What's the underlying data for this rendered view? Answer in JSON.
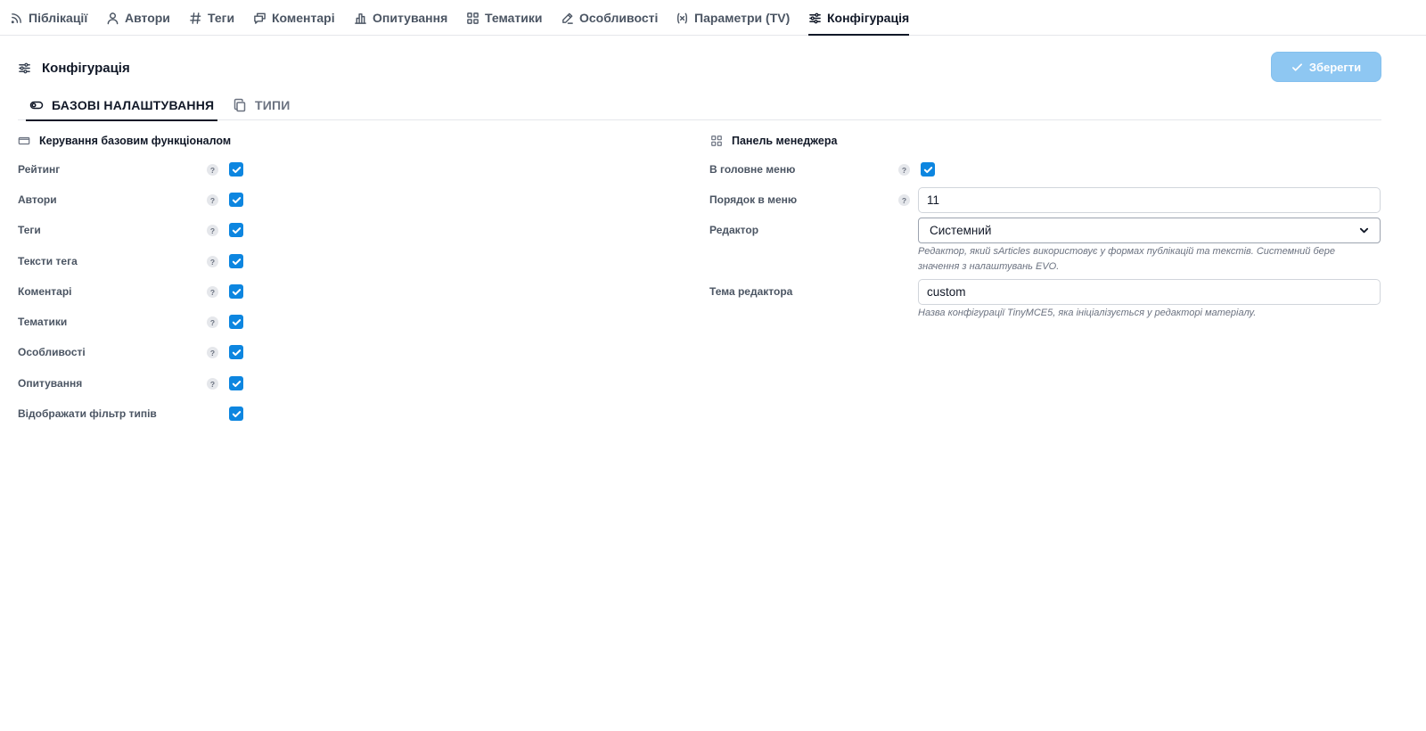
{
  "topnav": {
    "items": [
      {
        "label": "Піблікації",
        "icon": "rss-icon"
      },
      {
        "label": "Автори",
        "icon": "user-icon"
      },
      {
        "label": "Теги",
        "icon": "hash-icon"
      },
      {
        "label": "Коментарі",
        "icon": "comments-icon"
      },
      {
        "label": "Опитування",
        "icon": "chart-bar-icon"
      },
      {
        "label": "Тематики",
        "icon": "grid-icon"
      },
      {
        "label": "Особливості",
        "icon": "pen-icon"
      },
      {
        "label": "Параметри (TV)",
        "icon": "variable-icon"
      },
      {
        "label": "Конфігурація",
        "icon": "sliders-icon",
        "active": true
      }
    ]
  },
  "header": {
    "title": "Конфігурація",
    "save_label": "Зберегти"
  },
  "subtabs": [
    {
      "label": "БАЗОВІ НАЛАШТУВАННЯ",
      "icon": "toggle-icon",
      "active": true
    },
    {
      "label": "ТИПИ",
      "icon": "copy-icon"
    }
  ],
  "basic": {
    "title": "Керування базовим функціоналом",
    "rows": [
      {
        "label": "Рейтинг",
        "help": "?",
        "checked": true
      },
      {
        "label": "Автори",
        "help": "?",
        "checked": true
      },
      {
        "label": "Теги",
        "help": "?",
        "checked": true
      },
      {
        "label": "Тексти тега",
        "help": "?",
        "checked": true
      },
      {
        "label": "Коментарі",
        "help": "?",
        "checked": true
      },
      {
        "label": "Тематики",
        "help": "?",
        "checked": true
      },
      {
        "label": "Особливості",
        "help": "?",
        "checked": true
      },
      {
        "label": "Опитування",
        "help": "?",
        "checked": true
      },
      {
        "label": "Відображати фільтр типів",
        "checked": true
      }
    ]
  },
  "manager": {
    "title": "Панель менеджера",
    "main_menu": {
      "label": "В головне меню",
      "help": "?",
      "checked": true
    },
    "menu_order": {
      "label": "Порядок в меню",
      "help": "?",
      "value": "11"
    },
    "editor": {
      "label": "Редактор",
      "value": "Системний",
      "hint": "Редактор, який sArticles використовує у формах публікацій та текстів. Системний бере значення з налаштувань EVO."
    },
    "editor_theme": {
      "label": "Тема редактора",
      "value": "custom",
      "hint": "Назва конфігурації TinyMCE5, яка ініціалізується у редакторі матеріалу."
    }
  },
  "colors": {
    "accent": "#0d86e0",
    "save_button": "#8ec7f2"
  }
}
